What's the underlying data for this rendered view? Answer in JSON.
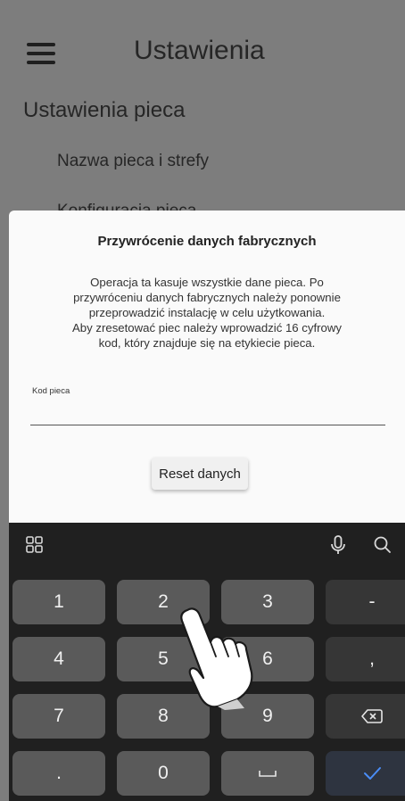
{
  "app": {
    "title": "Ustawienia",
    "section_title": "Ustawienia pieca",
    "menu_items": [
      "Nazwa pieca i strefy",
      "Konfiguracja pieca"
    ]
  },
  "dialog": {
    "title": "Przywrócenie danych fabrycznych",
    "message": "Operacja ta kasuje wszystkie dane pieca. Po\nprzywróceniu danych fabrycznych należy ponownie\nprzeprowadzić instalację w celu użytkowania.\nAby zresetować piec należy wprowadzić 16 cyfrowy\nkod, który znajduje się na etykiecie pieca.",
    "field_label": "Kod pieca",
    "field_value": "",
    "button_label": "Reset danych"
  },
  "keyboard": {
    "rows": [
      [
        "1",
        "2",
        "3",
        "-"
      ],
      [
        "4",
        "5",
        "6",
        ","
      ],
      [
        "7",
        "8",
        "9",
        "⌫"
      ],
      [
        ".",
        "0",
        "␣",
        "✓"
      ]
    ],
    "accent_color": "#4a8df8"
  },
  "icons": [
    "menu-icon",
    "grid-icon",
    "mic-icon",
    "search-icon",
    "backspace-icon",
    "space-icon",
    "check-icon",
    "hand-pointer-icon"
  ]
}
